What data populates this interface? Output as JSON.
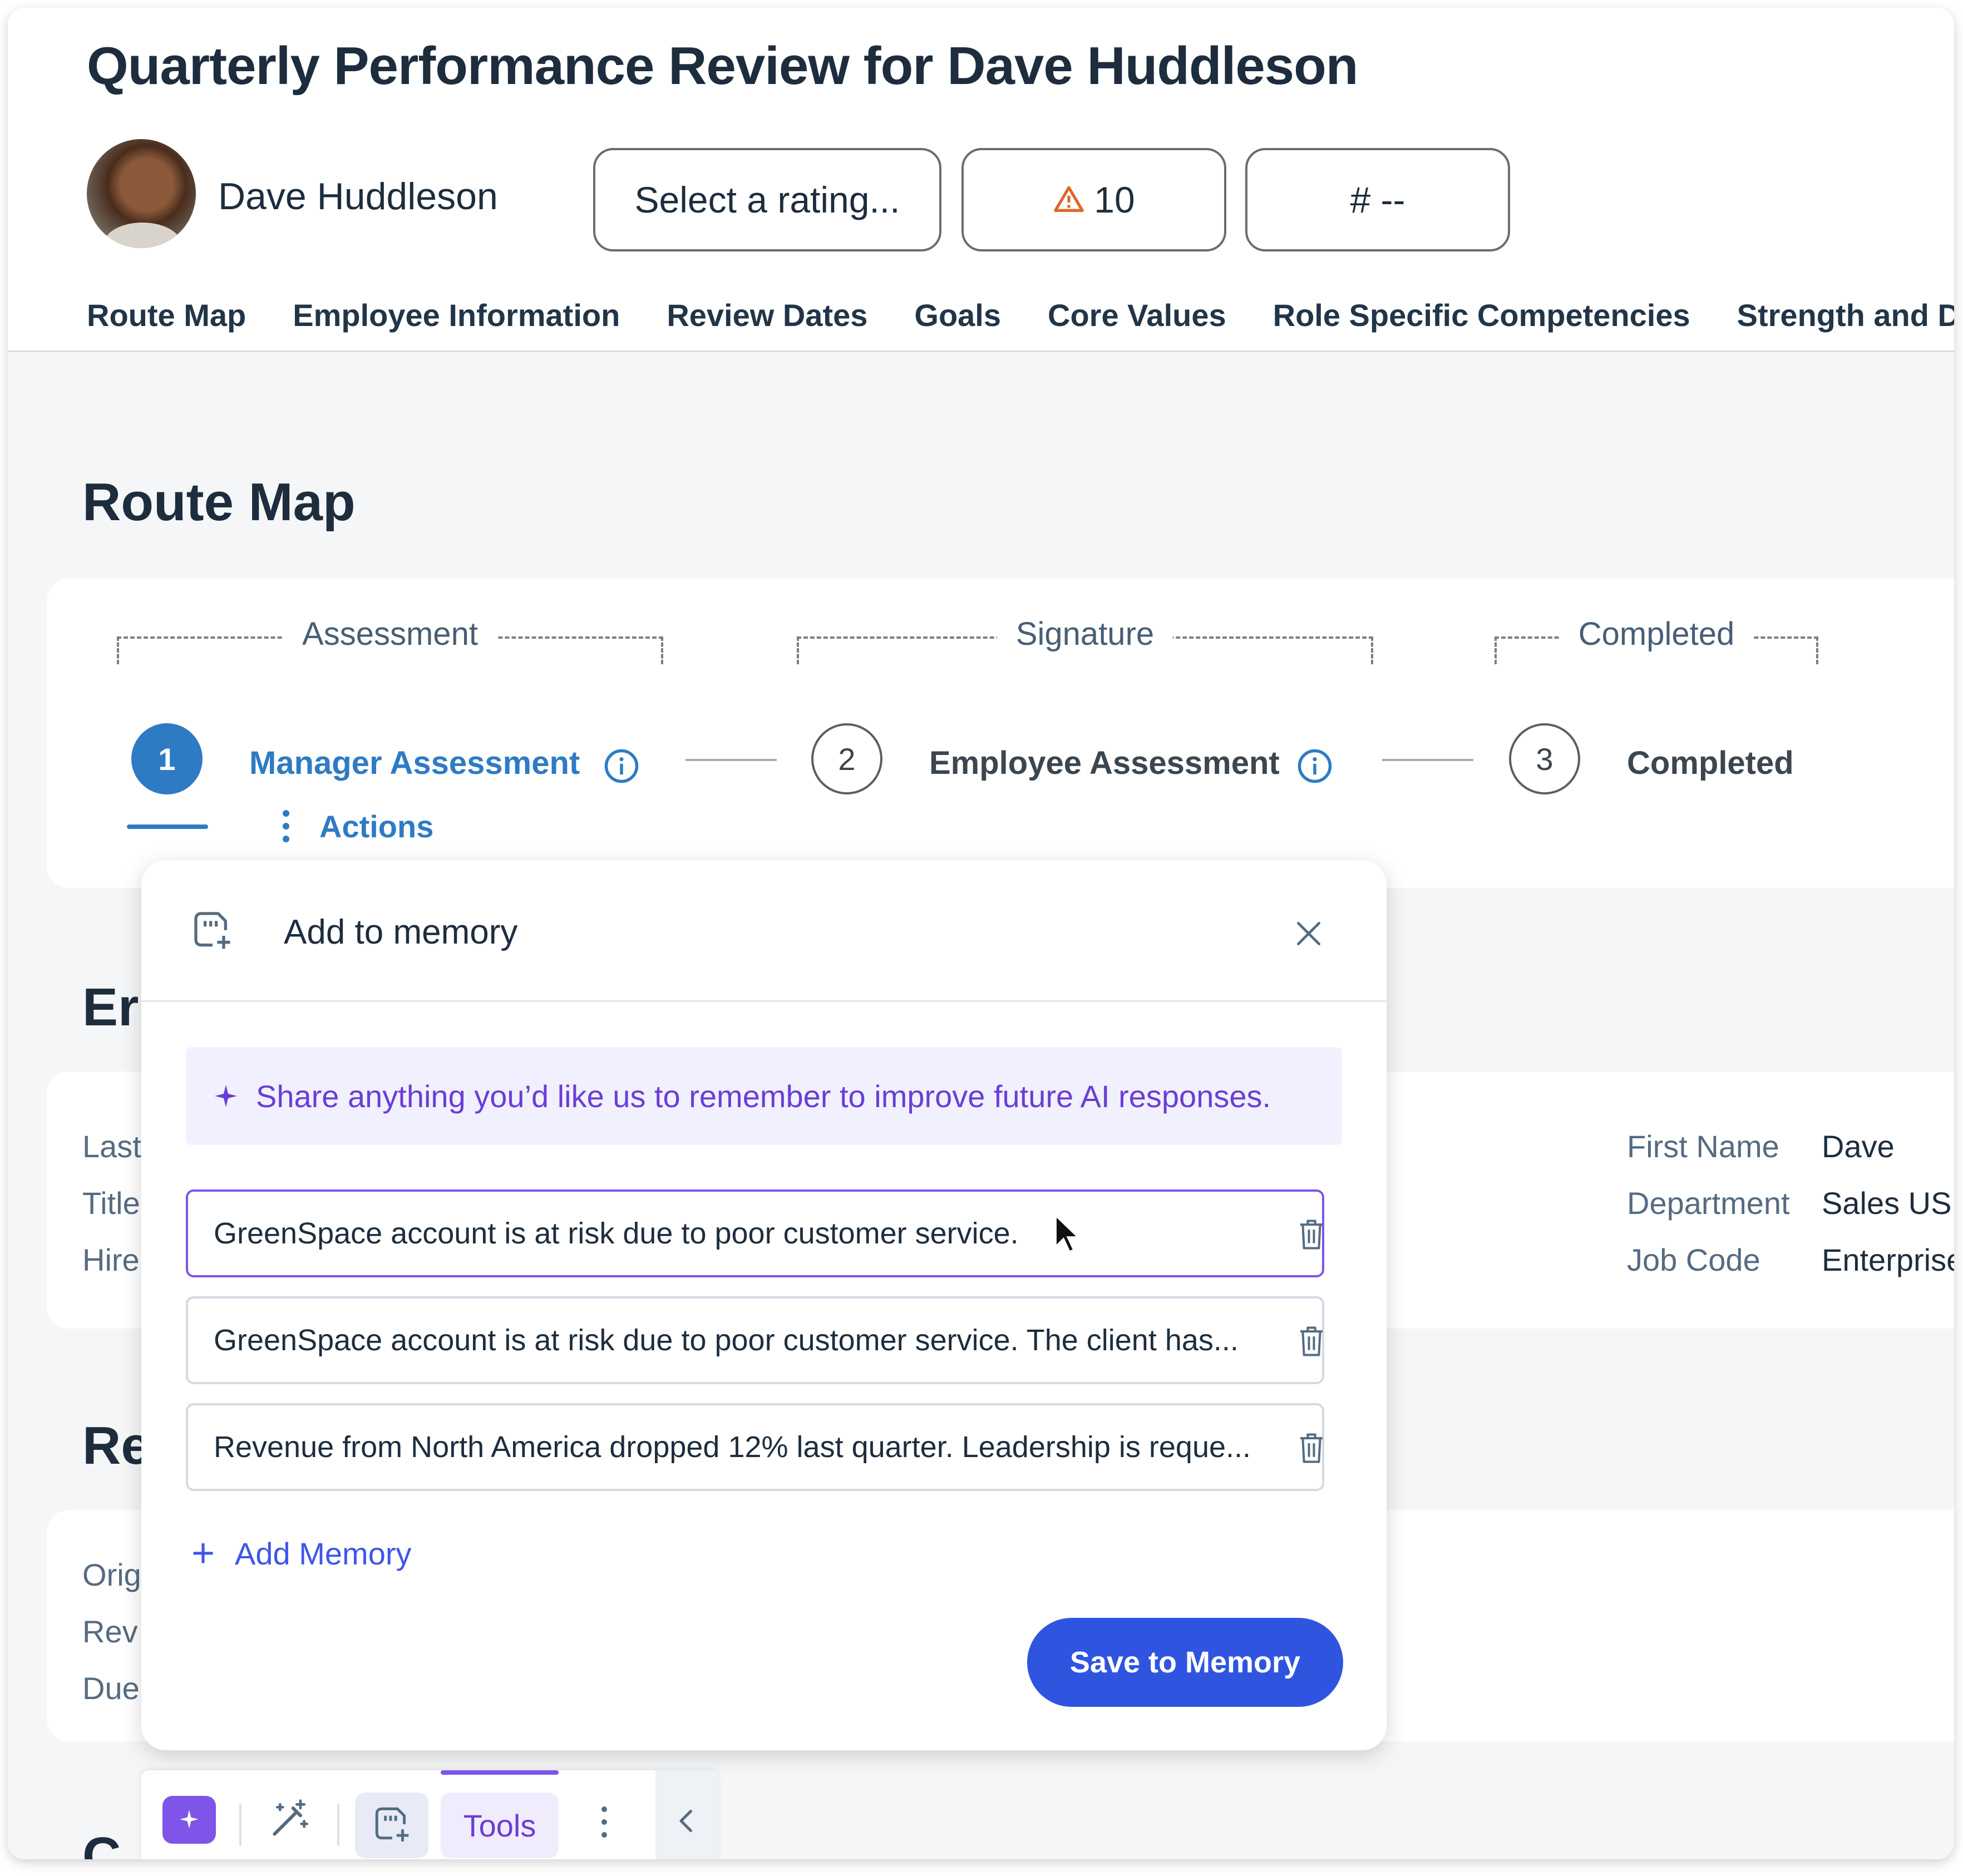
{
  "header": {
    "title": "Quarterly Performance Review for Dave Huddleson",
    "employee_name": "Dave Huddleson",
    "rating_placeholder": "Select a rating...",
    "warning_count": "10",
    "number_field": "# --",
    "tabs": [
      "Route Map",
      "Employee Information",
      "Review Dates",
      "Goals",
      "Core Values",
      "Role Specific Competencies",
      "Strength and D"
    ]
  },
  "route_map": {
    "title": "Route Map",
    "phases": [
      "Assessment",
      "Signature",
      "Completed"
    ],
    "steps": [
      {
        "number": "1",
        "label": "Manager Assessment"
      },
      {
        "number": "2",
        "label": "Employee Assessment"
      },
      {
        "number": "3",
        "label": "Completed"
      }
    ],
    "actions_label": "Actions"
  },
  "employee_section": {
    "title_fragment": "Er",
    "left_labels": [
      "Last",
      "Title",
      "Hire"
    ],
    "right_fields": [
      {
        "label": "First Name",
        "value": "Dave"
      },
      {
        "label": "Department",
        "value": "Sales US"
      },
      {
        "label": "Job Code",
        "value": "Enterprise"
      }
    ]
  },
  "review_section": {
    "title_fragment": "Re",
    "labels": [
      "Orig",
      "Rev",
      "Due"
    ]
  },
  "next_section": {
    "title_fragment": "C"
  },
  "dialog": {
    "title": "Add to memory",
    "notice": "Share anything you’d like us to remember to improve future AI responses.",
    "memories": [
      "GreenSpace account is at risk due to poor customer service.",
      "GreenSpace account is at risk due to poor customer service. The client has...",
      "Revenue from North America dropped 12% last quarter. Leadership is reque..."
    ],
    "add_label": "Add Memory",
    "save_label": "Save to Memory"
  },
  "toolbar": {
    "tools_label": "Tools"
  },
  "colors": {
    "accent_blue": "#2e7bc4",
    "primary_button": "#2f55e0",
    "ai_purple": "#7e55e8",
    "warning": "#e0682b"
  }
}
